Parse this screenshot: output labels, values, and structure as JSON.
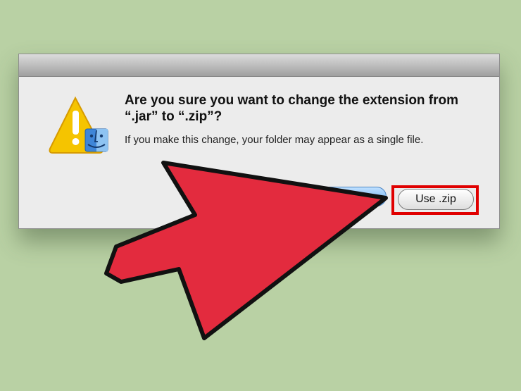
{
  "dialog": {
    "title": "Are you sure you want to change the extension from “.jar” to “.zip”?",
    "message": "If you make this change, your folder may appear as a single file.",
    "button_use_zip": "Use .zip"
  },
  "icons": {
    "warning": "warning-icon",
    "finder": "finder-icon",
    "arrow": "red-arrow-icon"
  },
  "colors": {
    "background": "#b9d1a4",
    "arrow": "#e32b3e",
    "highlight": "#e00000"
  }
}
